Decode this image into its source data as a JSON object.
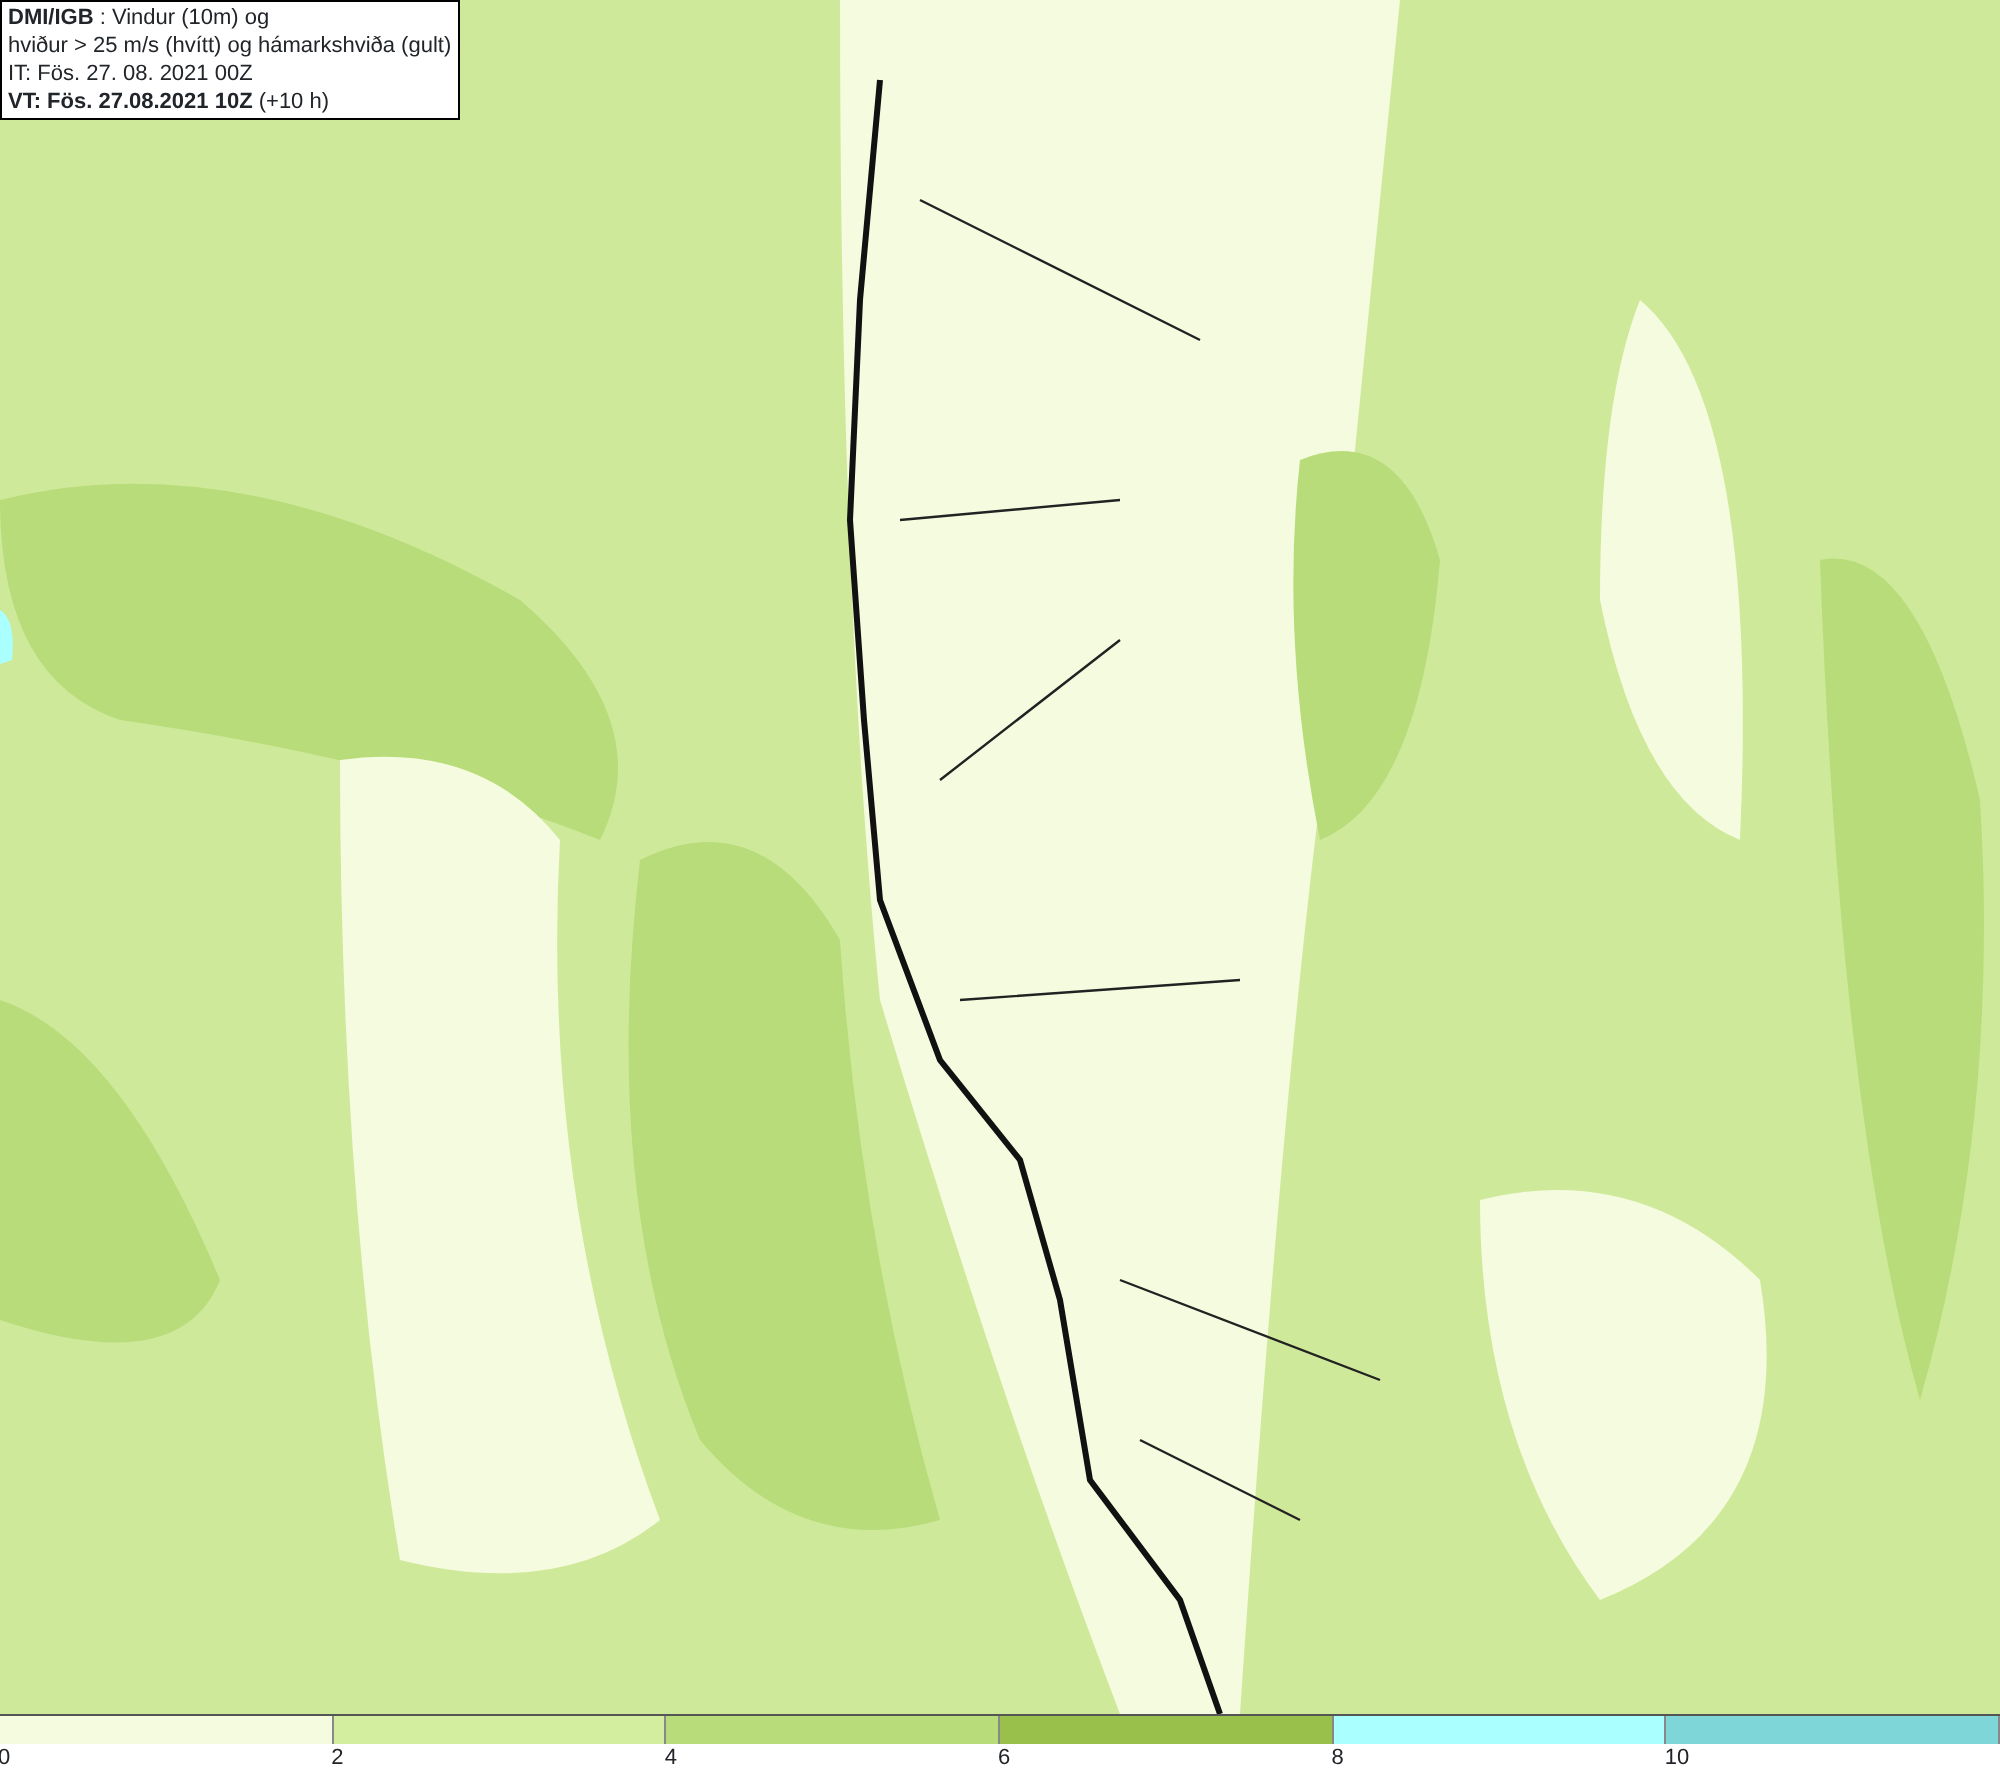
{
  "title_box": {
    "lines": [
      "**DMI/IGB** : Vindur (10m) og",
      "hviður > 25 m/s (hvítt) og hámarkshviða (gult)",
      "IT: Fös. 27. 08. 2021 00Z",
      "**VT: Fös. 27.08.2021 10Z** (+10 h)"
    ]
  },
  "legend": {
    "segments": [
      {
        "color": "#f5fbdf"
      },
      {
        "color": "#d4ee9f"
      },
      {
        "color": "#b8dc7a"
      },
      {
        "color": "#98c04a"
      },
      {
        "color": "#aaffff"
      },
      {
        "color": "#7ed6d8"
      }
    ],
    "ticks": [
      "0",
      "2",
      "4",
      "6",
      "8",
      "10"
    ]
  }
}
